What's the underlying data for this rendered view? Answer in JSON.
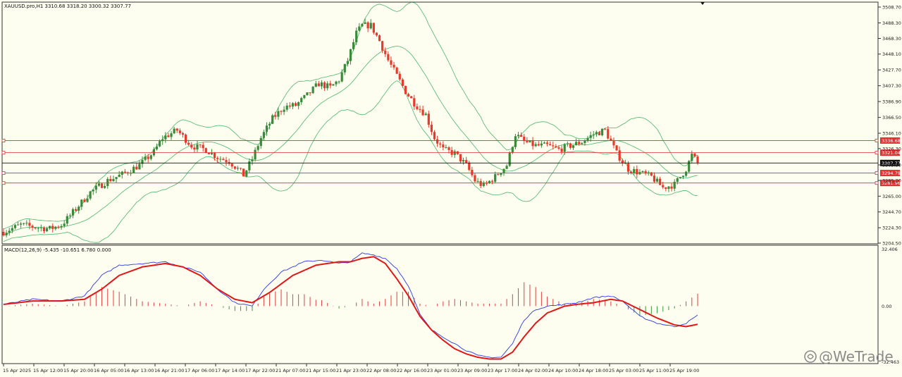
{
  "chart_data": [
    {
      "type": "candlestick",
      "title": "XAUUSD.pro,H1  3310.68 3318.20 3300.32 3307.77",
      "symbol": "XAUUSD.pro",
      "timeframe": "H1",
      "ohlc_header": {
        "open": 3310.68,
        "high": 3318.2,
        "low": 3300.32,
        "close": 3307.77
      },
      "y_axis": {
        "ticks": [
          "3508.70",
          "3488.30",
          "3468.30",
          "3448.10",
          "3427.70",
          "3407.30",
          "3386.90",
          "3366.50",
          "3346.10",
          "3326.30",
          "3305.30",
          "3285.20",
          "3265.00",
          "3244.70",
          "3224.30",
          "3204.50"
        ],
        "range": [
          3204.5,
          3508.7
        ]
      },
      "x_ticks": [
        "15 Apr 2025",
        "15 Apr 12:00",
        "15 Apr 20:00",
        "16 Apr 05:00",
        "16 Apr 13:00",
        "16 Apr 21:00",
        "17 Apr 06:00",
        "17 Apr 14:00",
        "17 Apr 22:00",
        "21 Apr 07:00",
        "21 Apr 15:00",
        "21 Apr 23:00",
        "22 Apr 08:00",
        "22 Apr 16:00",
        "23 Apr 01:00",
        "23 Apr 09:00",
        "23 Apr 17:00",
        "24 Apr 02:00",
        "24 Apr 10:00",
        "24 Apr 18:00",
        "25 Apr 03:00",
        "25 Apr 11:00",
        "25 Apr 19:00"
      ],
      "horizontal_lines": [
        {
          "price": 3336.68,
          "label": "3336.68",
          "color": "#e03030"
        },
        {
          "price": 3321.04,
          "label": "3321.04",
          "color": "#e03030"
        },
        {
          "price": 3307.77,
          "label": "3307.77",
          "color": "#111111",
          "current": true
        },
        {
          "price": 3294.79,
          "label": "3294.79",
          "color": "#e03030"
        },
        {
          "price": 3281.96,
          "label": "3281.96",
          "color": "#e03030"
        }
      ],
      "indicator": "Bollinger Bands",
      "price_path": [
        [
          0,
          3219
        ],
        [
          6,
          3228
        ],
        [
          11,
          3225
        ],
        [
          16,
          3223
        ],
        [
          20,
          3228
        ],
        [
          23,
          3240
        ],
        [
          30,
          3270
        ],
        [
          36,
          3285
        ],
        [
          41,
          3293
        ],
        [
          47,
          3305
        ],
        [
          52,
          3322
        ],
        [
          55,
          3340
        ],
        [
          60,
          3350
        ],
        [
          65,
          3330
        ],
        [
          70,
          3325
        ],
        [
          74,
          3315
        ],
        [
          78,
          3310
        ],
        [
          81,
          3300
        ],
        [
          83,
          3292
        ],
        [
          86,
          3313
        ],
        [
          89,
          3340
        ],
        [
          93,
          3365
        ],
        [
          97,
          3380
        ],
        [
          101,
          3382
        ],
        [
          105,
          3395
        ],
        [
          109,
          3410
        ],
        [
          113,
          3405
        ],
        [
          116,
          3415
        ],
        [
          119,
          3440
        ],
        [
          122,
          3475
        ],
        [
          124,
          3485
        ],
        [
          127,
          3485
        ],
        [
          130,
          3465
        ],
        [
          133,
          3440
        ],
        [
          136,
          3420
        ],
        [
          139,
          3400
        ],
        [
          142,
          3385
        ],
        [
          146,
          3370
        ],
        [
          149,
          3340
        ],
        [
          152,
          3325
        ],
        [
          156,
          3320
        ],
        [
          160,
          3305
        ],
        [
          163,
          3285
        ],
        [
          166,
          3278
        ],
        [
          170,
          3290
        ],
        [
          174,
          3305
        ],
        [
          177,
          3345
        ],
        [
          180,
          3335
        ],
        [
          184,
          3330
        ],
        [
          188,
          3330
        ],
        [
          192,
          3325
        ],
        [
          196,
          3330
        ],
        [
          200,
          3335
        ],
        [
          204,
          3345
        ],
        [
          208,
          3350
        ],
        [
          212,
          3320
        ],
        [
          216,
          3300
        ],
        [
          220,
          3295
        ],
        [
          224,
          3290
        ],
        [
          228,
          3276
        ],
        [
          232,
          3280
        ],
        [
          236,
          3300
        ],
        [
          238,
          3318
        ],
        [
          240,
          3307.77
        ]
      ],
      "candle_count": 241,
      "colors": {
        "bull": "#3a8a3a",
        "bear": "#e83a2a",
        "bands": "#4ab86a"
      }
    },
    {
      "type": "macd",
      "title": "MACD(12,26,9) -5.435 -10.651 6.780 0.000",
      "params": "12,26,9",
      "values": {
        "macd": -5.435,
        "signal": -10.651,
        "histogram": 6.78,
        "zero": 0.0
      },
      "y_axis": {
        "top": "32.406",
        "zero": "0.00",
        "bottom": "-32.463",
        "range": [
          -32.463,
          32.406
        ]
      },
      "macd_line": [
        [
          0,
          1
        ],
        [
          10,
          4
        ],
        [
          20,
          3
        ],
        [
          28,
          6
        ],
        [
          34,
          18
        ],
        [
          40,
          24
        ],
        [
          48,
          25
        ],
        [
          56,
          26
        ],
        [
          62,
          23
        ],
        [
          68,
          20
        ],
        [
          74,
          10
        ],
        [
          80,
          2
        ],
        [
          86,
          0
        ],
        [
          90,
          10
        ],
        [
          96,
          20
        ],
        [
          104,
          26
        ],
        [
          110,
          27
        ],
        [
          116,
          25
        ],
        [
          120,
          26
        ],
        [
          124,
          31
        ],
        [
          128,
          30
        ],
        [
          132,
          28
        ],
        [
          136,
          22
        ],
        [
          140,
          12
        ],
        [
          144,
          -5
        ],
        [
          148,
          -14
        ],
        [
          152,
          -18
        ],
        [
          156,
          -22
        ],
        [
          160,
          -26
        ],
        [
          164,
          -29
        ],
        [
          168,
          -30
        ],
        [
          172,
          -30
        ],
        [
          176,
          -22
        ],
        [
          180,
          -8
        ],
        [
          184,
          -2
        ],
        [
          188,
          0
        ],
        [
          194,
          1
        ],
        [
          198,
          2
        ],
        [
          204,
          5
        ],
        [
          210,
          6
        ],
        [
          214,
          3
        ],
        [
          220,
          -6
        ],
        [
          226,
          -10
        ],
        [
          232,
          -12
        ],
        [
          236,
          -10
        ],
        [
          240,
          -5.435
        ]
      ],
      "signal_line": [
        [
          0,
          1
        ],
        [
          10,
          3
        ],
        [
          20,
          3
        ],
        [
          28,
          4
        ],
        [
          34,
          10
        ],
        [
          40,
          18
        ],
        [
          48,
          23
        ],
        [
          56,
          25
        ],
        [
          62,
          23
        ],
        [
          68,
          18
        ],
        [
          74,
          10
        ],
        [
          80,
          4
        ],
        [
          86,
          2
        ],
        [
          92,
          8
        ],
        [
          100,
          18
        ],
        [
          108,
          24
        ],
        [
          116,
          26
        ],
        [
          120,
          26
        ],
        [
          124,
          28
        ],
        [
          128,
          29
        ],
        [
          132,
          25
        ],
        [
          136,
          16
        ],
        [
          140,
          6
        ],
        [
          144,
          -6
        ],
        [
          148,
          -14
        ],
        [
          152,
          -20
        ],
        [
          156,
          -25
        ],
        [
          160,
          -28
        ],
        [
          164,
          -30
        ],
        [
          168,
          -31
        ],
        [
          172,
          -31
        ],
        [
          176,
          -27
        ],
        [
          180,
          -18
        ],
        [
          184,
          -10
        ],
        [
          188,
          -4
        ],
        [
          194,
          0
        ],
        [
          198,
          1
        ],
        [
          204,
          2
        ],
        [
          210,
          4
        ],
        [
          214,
          3
        ],
        [
          220,
          -2
        ],
        [
          226,
          -7
        ],
        [
          232,
          -11
        ],
        [
          236,
          -12
        ],
        [
          240,
          -10.651
        ]
      ],
      "colors": {
        "macd": "#2a3ae0",
        "signal": "#e01818",
        "hist_pos": "#e04040",
        "hist_neg": "#3a9a3a"
      }
    }
  ],
  "watermark": "@WeTrade"
}
